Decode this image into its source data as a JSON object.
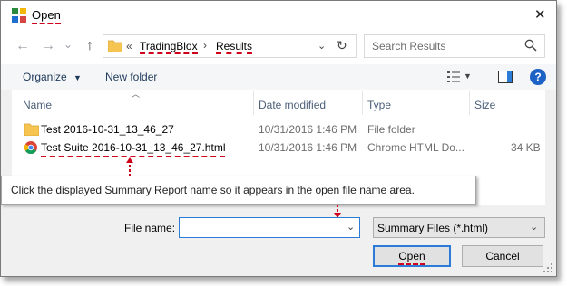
{
  "window": {
    "title": "Open",
    "close_glyph": "✕",
    "app_icon": "tradingblox-app-icon"
  },
  "nav": {
    "back": "←",
    "forward": "→",
    "recent": "⌄",
    "up": "↑",
    "breadcrumb_prefix": "«",
    "breadcrumb": [
      "TradingBlox",
      "Results"
    ],
    "breadcrumb_sep": "›",
    "refresh": "↻",
    "search_placeholder": "Search Results"
  },
  "toolbar": {
    "organize": "Organize",
    "new_folder": "New folder"
  },
  "columns": {
    "name": "Name",
    "date": "Date modified",
    "type": "Type",
    "size": "Size"
  },
  "files": [
    {
      "name": "Test 2016-10-31_13_46_27",
      "date": "10/31/2016 1:46 PM",
      "type": "File folder",
      "size": "",
      "icon": "folder-icon"
    },
    {
      "name": "Test Suite 2016-10-31_13_46_27.html",
      "date": "10/31/2016 1:46 PM",
      "type": "Chrome HTML Do...",
      "size": "34 KB",
      "icon": "chrome-icon"
    }
  ],
  "callout": {
    "text": "Click the displayed Summary Report name so it appears in the open file name area."
  },
  "bottom": {
    "file_name_label": "File name:",
    "file_name_value": "",
    "file_type": "Summary Files (*.html)",
    "open": "Open",
    "cancel": "Cancel"
  },
  "colors": {
    "annotation_red": "#d0021b",
    "accent_blue": "#2b7bd7",
    "header_text": "#4c607a"
  }
}
